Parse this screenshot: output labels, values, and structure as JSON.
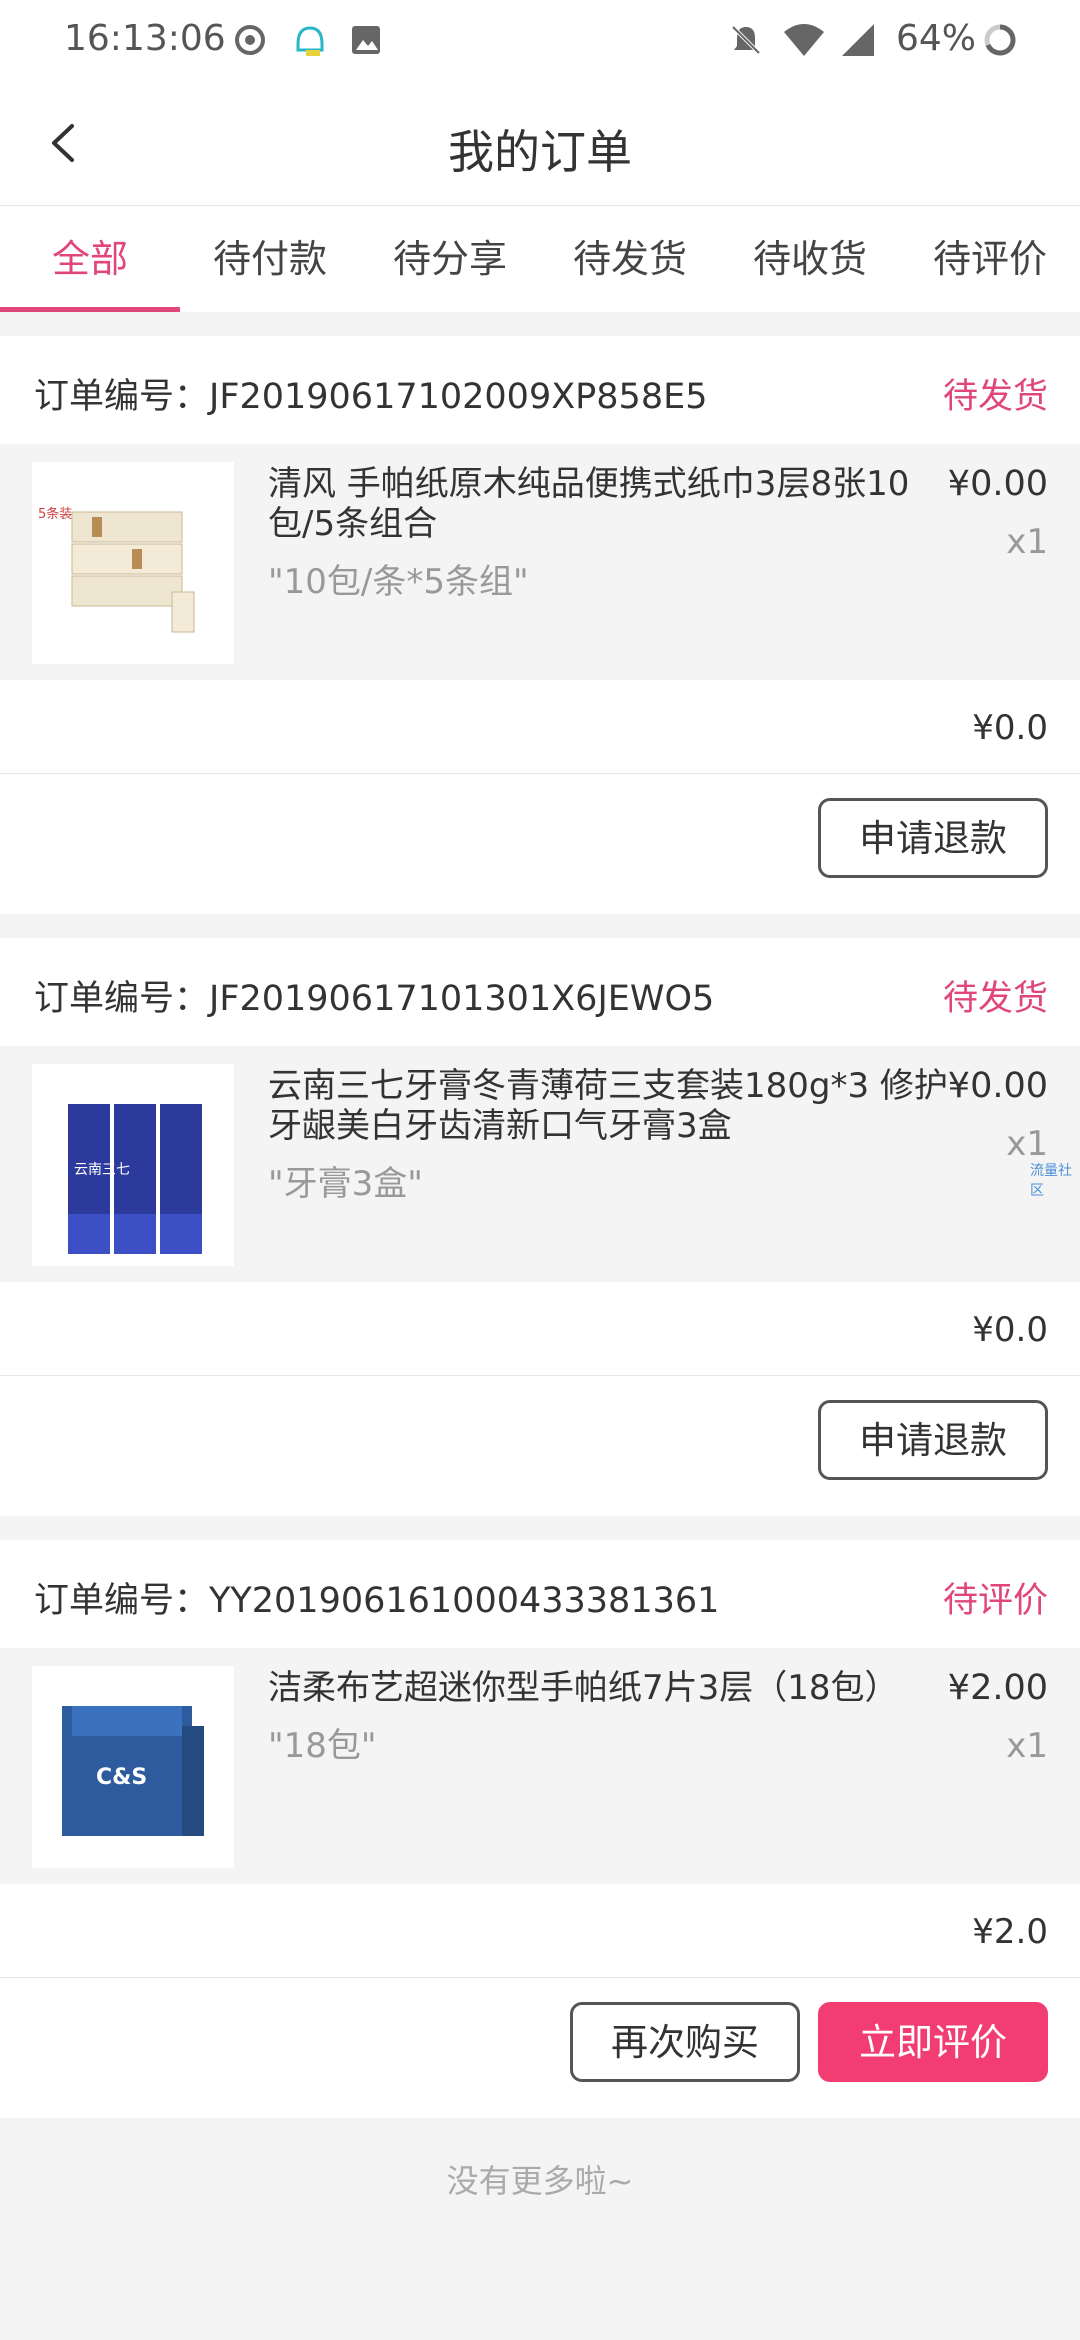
{
  "status_bar": {
    "time": "16:13:06",
    "battery": "64%",
    "icons": [
      "spiral-app-icon",
      "bot-notification-icon",
      "image-icon",
      "bell-muted-icon",
      "wifi-icon",
      "signal-icon",
      "battery-ring-icon"
    ]
  },
  "header": {
    "title": "我的订单"
  },
  "tabs": [
    {
      "label": "全部",
      "active": true
    },
    {
      "label": "待付款"
    },
    {
      "label": "待分享"
    },
    {
      "label": "待发货"
    },
    {
      "label": "待收货"
    },
    {
      "label": "待评价"
    }
  ],
  "orders": [
    {
      "order_no": "订单编号：JF20190617102009XP858E5",
      "status": "待发货",
      "item": {
        "name": "清风 手帕纸原木纯品便携式纸巾3层8张10包/5条组合",
        "spec": "\"10包/条*5条组\"",
        "price": "¥0.00",
        "qty": "x1",
        "thumb_text": "5条装"
      },
      "total": "¥0.0",
      "buttons": [
        "申请退款"
      ]
    },
    {
      "order_no": "订单编号：JF20190617101301X6JEWO5",
      "status": "待发货",
      "item": {
        "name": "云南三七牙膏冬青薄荷三支套装180g*3 修护牙龈美白牙齿清新口气牙膏3盒",
        "spec": "\"牙膏3盒\"",
        "price": "¥0.00",
        "qty": "x1",
        "thumb_text": "云南三七"
      },
      "total": "¥0.0",
      "buttons": [
        "申请退款"
      ]
    },
    {
      "order_no": "订单编号：YY20190616100043338136​1",
      "status": "待评价",
      "item": {
        "name": "洁柔布艺超迷你型手帕纸7片3层（18包）",
        "spec": "\"18包\"",
        "price": "¥2.00",
        "qty": "x1",
        "thumb_text": "C&S"
      },
      "total": "¥2.0",
      "buttons": [
        "再次购买",
        "立即评价"
      ]
    }
  ],
  "watermark": "流量社区",
  "footer": "没有更多啦~",
  "colors": {
    "accent": "#e0467c",
    "primary_button": "#f23d72"
  }
}
